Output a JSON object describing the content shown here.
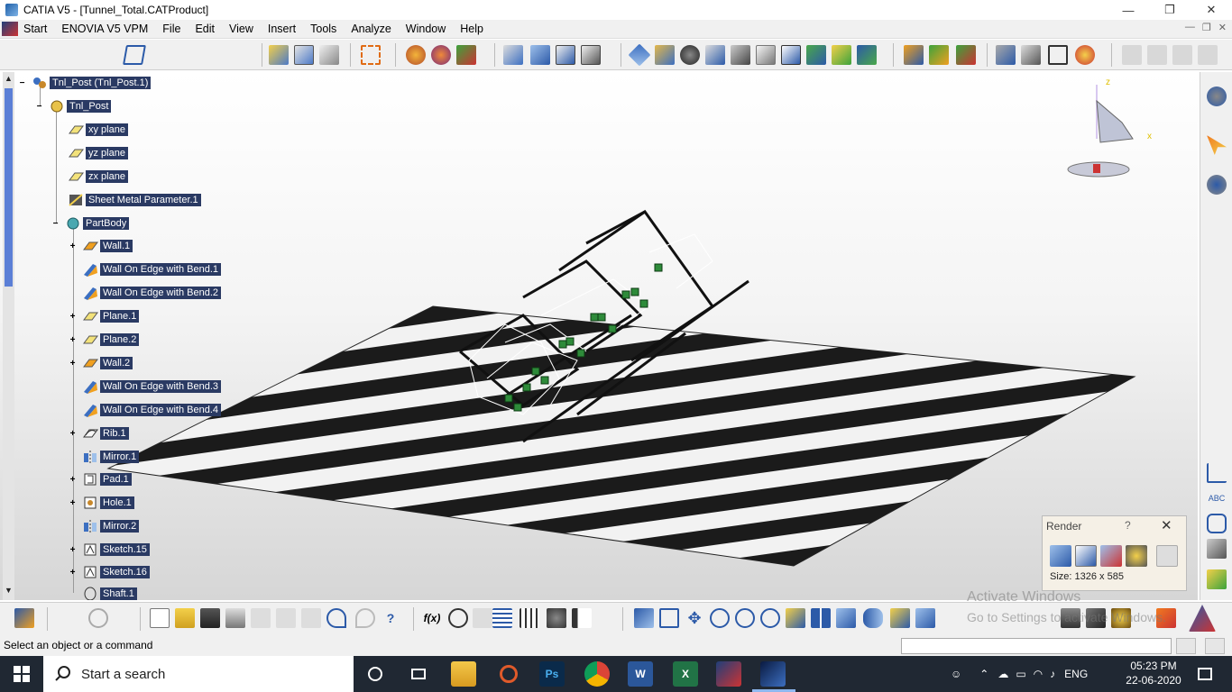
{
  "window": {
    "title": "CATIA V5 - [Tunnel_Total.CATProduct]",
    "controls": [
      "—",
      "❐",
      "✕"
    ]
  },
  "menu": {
    "items": [
      "Start",
      "ENOVIA V5 VPM",
      "File",
      "Edit",
      "View",
      "Insert",
      "Tools",
      "Analyze",
      "Window",
      "Help"
    ]
  },
  "tree": {
    "nodes": [
      {
        "label": "Tnl_Post (Tnl_Post.1)",
        "icon": "product-icon"
      },
      {
        "label": "Tnl_Post",
        "icon": "part-icon"
      },
      {
        "label": "xy plane",
        "icon": "plane-icon"
      },
      {
        "label": "yz plane",
        "icon": "plane-icon"
      },
      {
        "label": "zx plane",
        "icon": "plane-icon"
      },
      {
        "label": "Sheet Metal Parameter.1",
        "icon": "sheet-metal-parameter-icon"
      },
      {
        "label": "PartBody",
        "icon": "body-icon"
      },
      {
        "label": "Wall.1",
        "icon": "wall-icon"
      },
      {
        "label": "Wall On Edge with Bend.1",
        "icon": "wall-on-edge-icon"
      },
      {
        "label": "Wall On Edge with Bend.2",
        "icon": "wall-on-edge-icon"
      },
      {
        "label": "Plane.1",
        "icon": "plane-icon"
      },
      {
        "label": "Plane.2",
        "icon": "plane-icon"
      },
      {
        "label": "Wall.2",
        "icon": "wall-icon"
      },
      {
        "label": "Wall On Edge with Bend.3",
        "icon": "wall-on-edge-icon"
      },
      {
        "label": "Wall On Edge with Bend.4",
        "icon": "wall-on-edge-icon"
      },
      {
        "label": "Rib.1",
        "icon": "rib-icon"
      },
      {
        "label": "Mirror.1",
        "icon": "mirror-icon"
      },
      {
        "label": "Pad.1",
        "icon": "pad-icon"
      },
      {
        "label": "Hole.1",
        "icon": "hole-icon"
      },
      {
        "label": "Mirror.2",
        "icon": "mirror-icon"
      },
      {
        "label": "Sketch.15",
        "icon": "sketch-icon"
      },
      {
        "label": "Sketch.16",
        "icon": "sketch-icon"
      },
      {
        "label": "Shaft.1",
        "icon": "shaft-icon"
      }
    ]
  },
  "render_dialog": {
    "title": "Render",
    "help": "?",
    "close": "✕",
    "size_text": "Size: 1326 x 585"
  },
  "status": {
    "message": "Select an object or a command"
  },
  "watermark": {
    "line1": "Activate Windows",
    "line2": "Go to Settings to activate Windows."
  },
  "compass": {
    "axis_z": "z",
    "axis_x": "x"
  },
  "taskbar": {
    "search_placeholder": "Start a search",
    "language": "ENG",
    "time": "05:23 PM",
    "date": "22-06-2020",
    "apps": [
      "cortana-icon",
      "task-view-icon",
      "file-explorer-icon",
      "media-player-icon",
      "photoshop-icon",
      "chrome-icon",
      "word-icon",
      "excel-icon",
      "catia-icon",
      "catia-active-icon"
    ],
    "photoshop_label": "Ps",
    "word_label": "W",
    "excel_label": "X"
  },
  "colors": {
    "tree_highlight": "#2a3a63",
    "taskbar_bg": "#202833",
    "render_dialog_bg": "#f5f0e6"
  }
}
